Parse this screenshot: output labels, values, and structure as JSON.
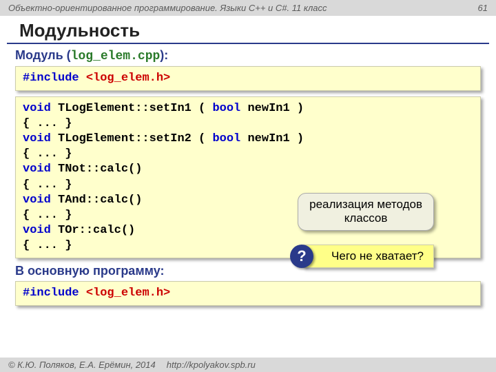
{
  "header": {
    "course": "Объектно-ориентированное программирование. Языки C++ и C#. 11 класс",
    "page": "61"
  },
  "title": "Модульность",
  "module": {
    "label_prefix": "Модуль (",
    "filename": "log_elem.cpp",
    "label_suffix": "):"
  },
  "include1": {
    "kw": "#include",
    "sp": " ",
    "val": "<log_elem.h>"
  },
  "code": {
    "l1a": "void",
    "l1b": " TLogElement::setIn1 ( ",
    "l1c": "bool",
    "l1d": " newIn1 )",
    "l2": "{ ... }",
    "l3a": "void",
    "l3b": " TLogElement::setIn2 ( ",
    "l3c": "bool",
    "l3d": " newIn1 )",
    "l4": "{ ... }",
    "l5a": "void",
    "l5b": " TNot::calc()",
    "l6": "{ ... }",
    "l7a": "void",
    "l7b": " TAnd::calc()",
    "l8": "{ ... }",
    "l9a": "void",
    "l9b": " TOr::calc()",
    "l10": "{ ... }"
  },
  "callout1_line1": "реализация методов",
  "callout1_line2": "классов",
  "callout2_text": "Чего не хватает?",
  "qmark": "?",
  "main_program_label": "В основную программу:",
  "include2": {
    "kw": "#include",
    "sp": " ",
    "val": "<log_elem.h>"
  },
  "footer": {
    "copyright": "© К.Ю. Поляков, Е.А. Ерёмин, 2014",
    "url": "http://kpolyakov.spb.ru"
  }
}
